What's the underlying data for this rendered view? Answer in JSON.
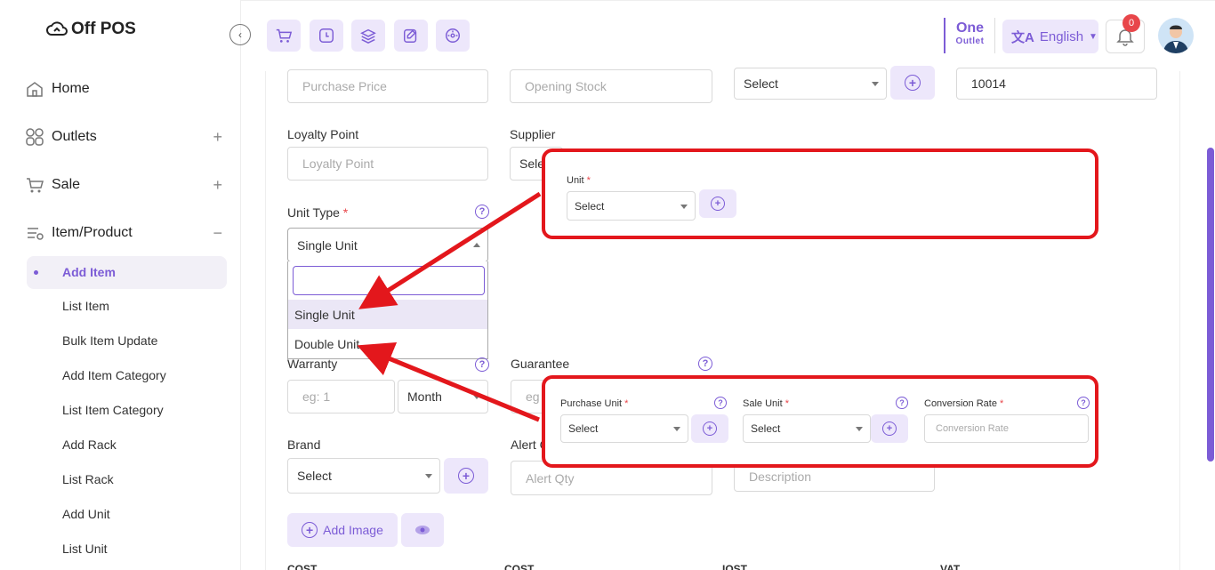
{
  "app": {
    "logo_text": "Off POS"
  },
  "sidebar": {
    "items": [
      {
        "label": "Home",
        "expander": ""
      },
      {
        "label": "Outlets",
        "expander": "+"
      },
      {
        "label": "Sale",
        "expander": "+"
      },
      {
        "label": "Item/Product",
        "expander": "−"
      }
    ],
    "sub_items": [
      {
        "label": "Add Item",
        "active": true
      },
      {
        "label": "List Item"
      },
      {
        "label": "Bulk Item Update"
      },
      {
        "label": "Add Item Category"
      },
      {
        "label": "List Item Category"
      },
      {
        "label": "Add Rack"
      },
      {
        "label": "List Rack"
      },
      {
        "label": "Add Unit"
      },
      {
        "label": "List Unit"
      }
    ]
  },
  "header": {
    "outlet_line1": "One",
    "outlet_line2": "Outlet",
    "language": "English",
    "notification_count": "0"
  },
  "form": {
    "purchase_price_placeholder": "Purchase Price",
    "opening_stock_placeholder": "Opening Stock",
    "top_select": "Select",
    "code_value": "10014",
    "loyalty_label": "Loyalty Point",
    "loyalty_placeholder": "Loyalty Point",
    "supplier_label": "Supplier",
    "supplier_value_partial": "Sele",
    "unit_type_label": "Unit Type",
    "required_mark": "*",
    "unit_type_value": "Single Unit",
    "unit_type_options": [
      "Single Unit",
      "Double Unit"
    ],
    "warranty_label": "Warranty",
    "warranty_placeholder": "eg: 1",
    "warranty_period": "Month",
    "guarantee_label": "Guarantee",
    "guarantee_placeholder_partial": "eg",
    "brand_label": "Brand",
    "brand_value": "Select",
    "alert_label_partial": "Alert C",
    "alert_placeholder": "Alert Qty",
    "description_placeholder": "Description",
    "add_image_label": "Add Image",
    "bottom_headers_partial": [
      "COST",
      "COST",
      "IOST",
      "VAT"
    ]
  },
  "callout_single": {
    "unit_label": "Unit",
    "unit_value": "Select"
  },
  "callout_double": {
    "purchase_unit_label": "Purchase Unit",
    "purchase_unit_value": "Select",
    "sale_unit_label": "Sale Unit",
    "sale_unit_value": "Select",
    "conversion_label": "Conversion Rate",
    "conversion_placeholder": "Conversion Rate"
  },
  "colors": {
    "accent": "#7c5cd6",
    "accent_light": "#ede7fb",
    "annotation_red": "#e3171c"
  }
}
